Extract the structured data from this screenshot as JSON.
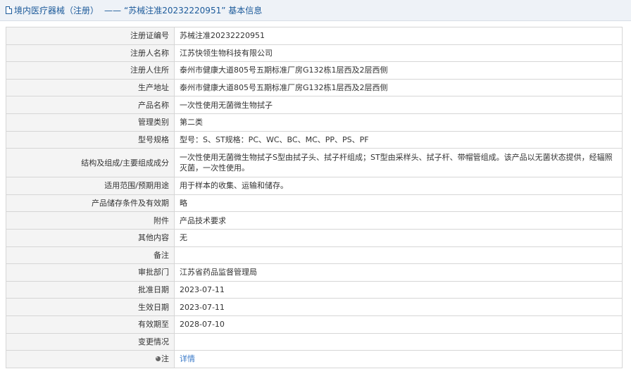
{
  "header": {
    "crumb": "境内医疗器械（注册）",
    "dash": "——",
    "title": "“苏械注准20232220951” 基本信息"
  },
  "rows": [
    {
      "label": "注册证编号",
      "value": "苏械注准20232220951"
    },
    {
      "label": "注册人名称",
      "value": "江苏快领生物科技有限公司"
    },
    {
      "label": "注册人住所",
      "value": "泰州市健康大道805号五期标准厂房G132栋1层西及2层西侧"
    },
    {
      "label": "生产地址",
      "value": "泰州市健康大道805号五期标准厂房G132栋1层西及2层西侧"
    },
    {
      "label": "产品名称",
      "value": "一次性使用无菌微生物拭子"
    },
    {
      "label": "管理类别",
      "value": "第二类"
    },
    {
      "label": "型号规格",
      "value": "型号：S、ST规格：PC、WC、BC、MC、PP、PS、PF"
    },
    {
      "label": "结构及组成/主要组成成分",
      "value": "一次性使用无菌微生物拭子S型由拭子头、拭子杆组成；ST型由采样头、拭子杆、带帽管组成。该产品以无菌状态提供，经辐照灭菌，一次性使用。"
    },
    {
      "label": "适用范围/预期用途",
      "value": "用于样本的收集、运输和储存。"
    },
    {
      "label": "产品储存条件及有效期",
      "value": "略"
    },
    {
      "label": "附件",
      "value": "产品技术要求"
    },
    {
      "label": "其他内容",
      "value": "无"
    },
    {
      "label": "备注",
      "value": ""
    },
    {
      "label": "审批部门",
      "value": "江苏省药品监督管理局"
    },
    {
      "label": "批准日期",
      "value": "2023-07-11"
    },
    {
      "label": "生效日期",
      "value": "2023-07-11"
    },
    {
      "label": "有效期至",
      "value": "2028-07-10"
    },
    {
      "label": "变更情况",
      "value": ""
    }
  ],
  "note_row": {
    "label": "注",
    "icon": "pin-icon",
    "link": "详情"
  }
}
